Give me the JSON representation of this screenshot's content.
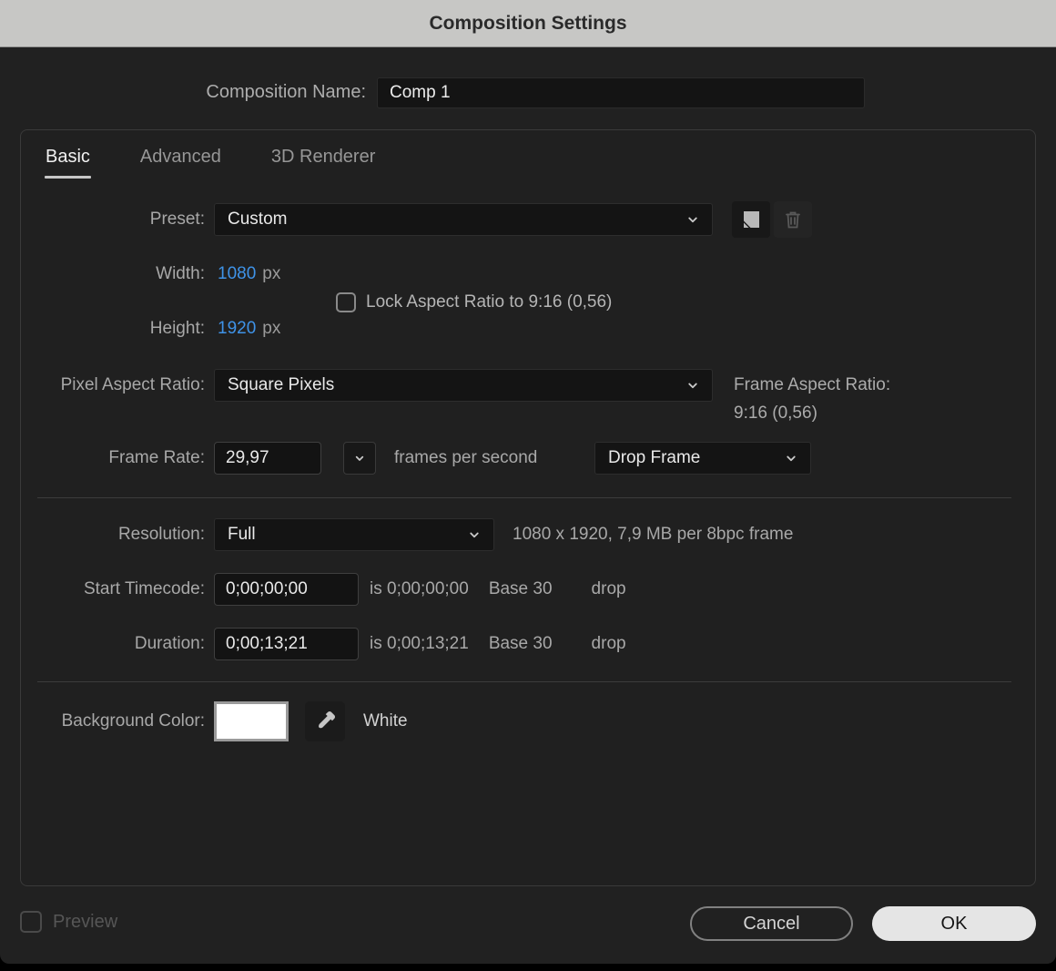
{
  "title_bar": {
    "title": "Composition Settings"
  },
  "name_row": {
    "label": "Composition Name:",
    "value": "Comp 1"
  },
  "tabs": [
    {
      "label": "Basic",
      "active": true
    },
    {
      "label": "Advanced",
      "active": false
    },
    {
      "label": "3D Renderer",
      "active": false
    }
  ],
  "basic": {
    "preset": {
      "label": "Preset:",
      "value": "Custom"
    },
    "width": {
      "label": "Width:",
      "value": "1080",
      "unit": "px"
    },
    "height": {
      "label": "Height:",
      "value": "1920",
      "unit": "px"
    },
    "lock_aspect": {
      "label": "Lock Aspect Ratio to 9:16 (0,56)",
      "checked": false
    },
    "pixel_aspect_ratio": {
      "label": "Pixel Aspect Ratio:",
      "value": "Square Pixels"
    },
    "frame_aspect_ratio": {
      "label": "Frame Aspect Ratio:",
      "value": "9:16 (0,56)"
    },
    "frame_rate": {
      "label": "Frame Rate:",
      "value": "29,97",
      "suffix": "frames per second",
      "dropdown_value": "Drop Frame"
    },
    "resolution": {
      "label": "Resolution:",
      "value": "Full",
      "info": "1080 x 1920, 7,9 MB per 8bpc frame"
    },
    "start_timecode": {
      "label": "Start Timecode:",
      "value": "0;00;00;00",
      "is_text": "is 0;00;00;00",
      "base_text": "Base 30",
      "drop_text": "drop"
    },
    "duration": {
      "label": "Duration:",
      "value": "0;00;13;21",
      "is_text": "is 0;00;13;21",
      "base_text": "Base 30",
      "drop_text": "drop"
    },
    "background_color": {
      "label": "Background Color:",
      "color": "#FFFFFF",
      "color_name": "White"
    }
  },
  "footer": {
    "preview_label": "Preview",
    "preview_checked": false,
    "cancel_label": "Cancel",
    "ok_label": "OK"
  },
  "icons": [
    "chevron-down-icon",
    "save-preset-icon",
    "trash-icon",
    "eyedropper-icon"
  ],
  "colors": {
    "titlebar_bg": "#C7C7C5",
    "dialog_bg": "#212121",
    "field_bg": "#141414",
    "accent_blue": "#3F93E8",
    "label_gray": "#A8A8A8",
    "value_white": "#E9E9E9",
    "ok_button_bg": "#E5E5E5",
    "swatch_white": "#FFFFFF"
  }
}
